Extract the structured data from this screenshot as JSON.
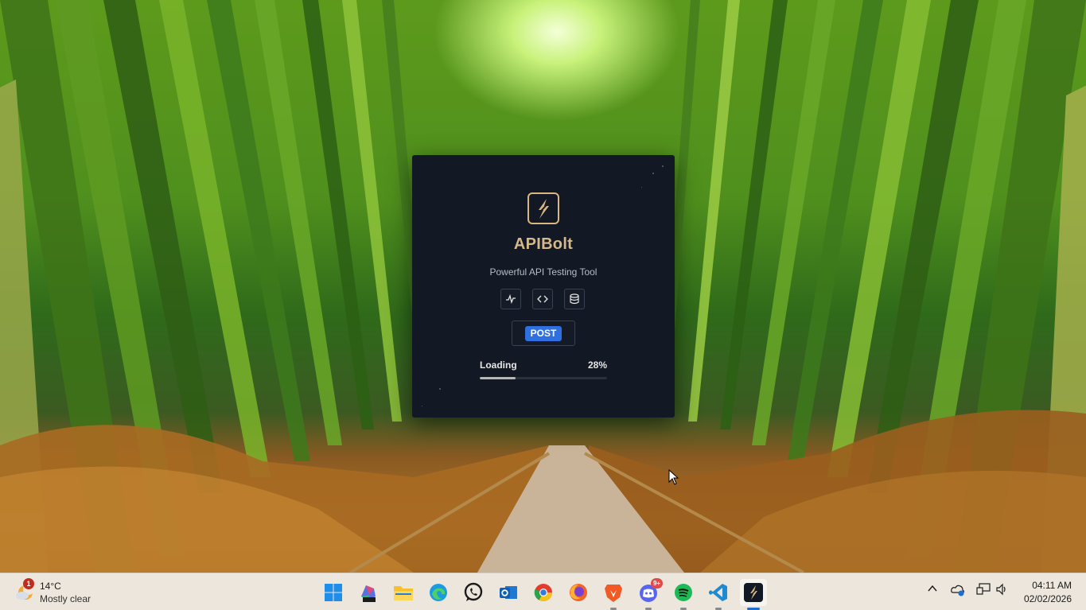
{
  "splash": {
    "app_name": "APIBolt",
    "subtitle": "Powerful API Testing Tool",
    "features": [
      "activity-icon",
      "code-icon",
      "database-icon"
    ],
    "method": "POST",
    "loading_label": "Loading",
    "progress_text": "28%",
    "progress": 0.28,
    "colors": {
      "background": "#121824",
      "accent": "#d5b98b",
      "method_badge": "#2f6fe0"
    }
  },
  "taskbar": {
    "weather": {
      "temp": "14°C",
      "desc": "Mostly clear",
      "badge": "1"
    },
    "apps": [
      {
        "name": "windows-start-icon"
      },
      {
        "name": "microsoft-365-icon"
      },
      {
        "name": "file-explorer-icon"
      },
      {
        "name": "edge-icon"
      },
      {
        "name": "whatsapp-icon"
      },
      {
        "name": "outlook-icon"
      },
      {
        "name": "chrome-icon"
      },
      {
        "name": "firefox-icon"
      },
      {
        "name": "brave-icon"
      },
      {
        "name": "discord-icon",
        "badge": "9+"
      },
      {
        "name": "spotify-icon"
      },
      {
        "name": "vscode-icon"
      },
      {
        "name": "apibolt-icon"
      }
    ],
    "clock": {
      "time": "04:11 AM",
      "date": "02/02/2026"
    }
  }
}
